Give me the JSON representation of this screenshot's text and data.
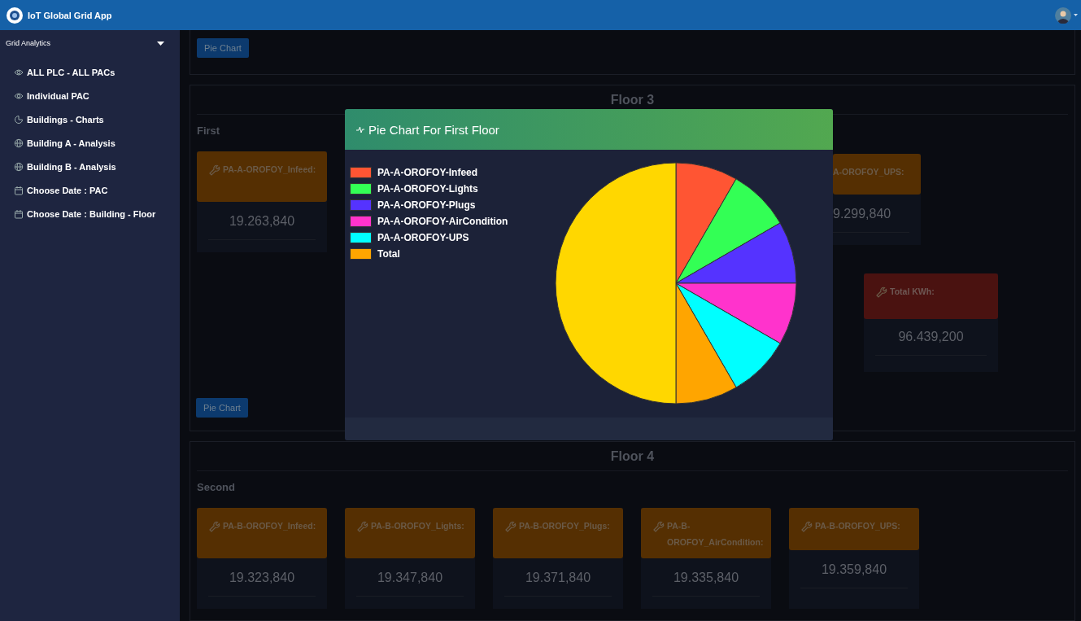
{
  "app": {
    "title": "IoT Global Grid App"
  },
  "sidebar": {
    "section": {
      "label": "Grid Analytics",
      "expanded": true
    },
    "items": [
      {
        "label": "ALL PLC - ALL PACs",
        "kind": "eye"
      },
      {
        "label": "Individual PAC",
        "kind": "eye"
      },
      {
        "label": "Buildings - Charts",
        "kind": "pie"
      },
      {
        "label": "Building A - Analysis",
        "kind": "globe"
      },
      {
        "label": "Building B - Analysis",
        "kind": "globe"
      },
      {
        "label": "Choose Date : PAC",
        "kind": "calendar"
      },
      {
        "label": "Choose Date : Building - Floor",
        "kind": "calendar"
      }
    ]
  },
  "top_panel": {
    "button": "Pie Chart"
  },
  "floors": [
    {
      "title": "Floor 3",
      "group": "First",
      "cards": [
        {
          "label": "PA-A-OROFOY_Infeed:",
          "value": "19.263,840",
          "kind": "meter"
        },
        {
          "label": "A-OROFOY_UPS:",
          "value": "9.299,840",
          "kind": "meter"
        },
        {
          "label": "Total KWh:",
          "value": "96.439,200",
          "kind": "total"
        }
      ],
      "button": "Pie Chart"
    },
    {
      "title": "Floor 4",
      "group": "Second",
      "cards": [
        {
          "label": "PA-B-OROFOY_Infeed:",
          "value": "19.323,840",
          "kind": "meter"
        },
        {
          "label": "PA-B-OROFOY_Lights:",
          "value": "19.347,840",
          "kind": "meter"
        },
        {
          "label": "PA-B-OROFOY_Plugs:",
          "value": "19.371,840",
          "kind": "meter"
        },
        {
          "label": "PA-B-OROFOY_AirCondition:",
          "value": "19.335,840",
          "kind": "meter"
        },
        {
          "label": "PA-B-OROFOY_UPS:",
          "value": "19.359,840",
          "kind": "meter"
        }
      ]
    }
  ],
  "modal": {
    "title": "Pie Chart For First Floor",
    "legend": [
      {
        "label": "PA-A-OROFOY-Infeed",
        "color": "#ff5533"
      },
      {
        "label": "PA-A-OROFOY-Lights",
        "color": "#33ff55"
      },
      {
        "label": "PA-A-OROFOY-Plugs",
        "color": "#5533ff"
      },
      {
        "label": "PA-A-OROFOY-AirCondition",
        "color": "#ff33cc"
      },
      {
        "label": "PA-A-OROFOY-UPS",
        "color": "#00ffff"
      },
      {
        "label": "Total",
        "color": "#ffa500"
      }
    ],
    "chart_data": {
      "type": "pie",
      "values": [
        8.33,
        8.33,
        8.33,
        8.33,
        8.33,
        8.35,
        50
      ],
      "colors": [
        "#ff5533",
        "#33ff55",
        "#5533ff",
        "#ff33cc",
        "#00ffff",
        "#ffa500",
        "#ffd700"
      ]
    }
  }
}
